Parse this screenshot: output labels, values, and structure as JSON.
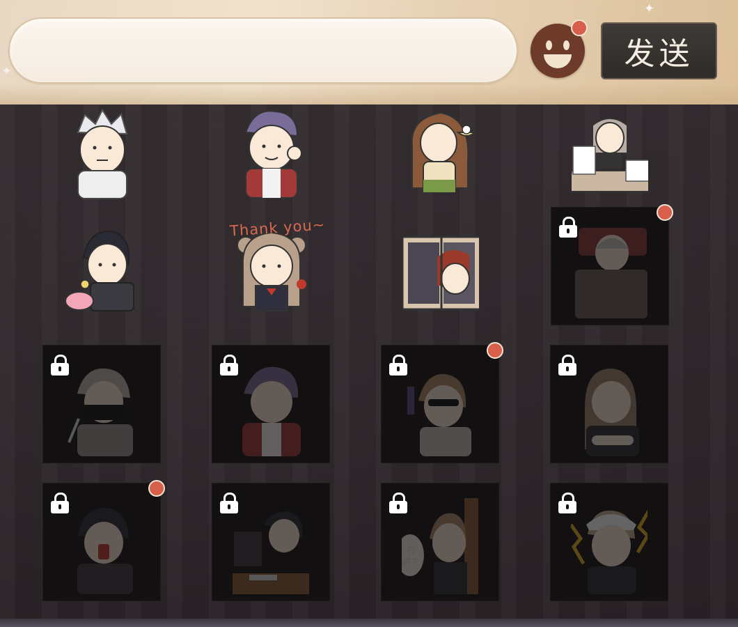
{
  "input": {
    "value": "",
    "placeholder": ""
  },
  "send_button": {
    "label": "发送"
  },
  "emoji_button": {
    "icon": "smiley-face-icon",
    "has_notification": true
  },
  "colors": {
    "notification": "#d8604a",
    "accent_bg": "#e8d8c3",
    "send_bg": "#2f2b29"
  },
  "stickers": [
    {
      "name": "sticker-white-hair-man",
      "locked": false,
      "notification": false,
      "caption": ""
    },
    {
      "name": "sticker-purple-hair-ok",
      "locked": false,
      "notification": false,
      "caption": ""
    },
    {
      "name": "sticker-girl-rice-bowl",
      "locked": false,
      "notification": false,
      "caption": ""
    },
    {
      "name": "sticker-paperwork-desk",
      "locked": false,
      "notification": false,
      "caption": ""
    },
    {
      "name": "sticker-piggy-bank",
      "locked": false,
      "notification": false,
      "caption": ""
    },
    {
      "name": "sticker-thank-you-girl",
      "locked": false,
      "notification": false,
      "caption": "Thank you~"
    },
    {
      "name": "sticker-window-peek",
      "locked": false,
      "notification": false,
      "caption": ""
    },
    {
      "name": "sticker-in-bed",
      "locked": true,
      "notification": true,
      "caption": ""
    },
    {
      "name": "sticker-masked-knife",
      "locked": true,
      "notification": false,
      "caption": ""
    },
    {
      "name": "sticker-purple-hair-smile",
      "locked": true,
      "notification": false,
      "caption": ""
    },
    {
      "name": "sticker-sunglasses-gun",
      "locked": true,
      "notification": true,
      "caption": ""
    },
    {
      "name": "sticker-arms-crossed",
      "locked": true,
      "notification": false,
      "caption": ""
    },
    {
      "name": "sticker-shouting",
      "locked": true,
      "notification": true,
      "caption": ""
    },
    {
      "name": "sticker-computer-desk",
      "locked": true,
      "notification": false,
      "caption": ""
    },
    {
      "name": "sticker-door-peek",
      "locked": true,
      "notification": false,
      "caption": "在吗？"
    },
    {
      "name": "sticker-angry-maid",
      "locked": true,
      "notification": false,
      "caption": ""
    }
  ]
}
